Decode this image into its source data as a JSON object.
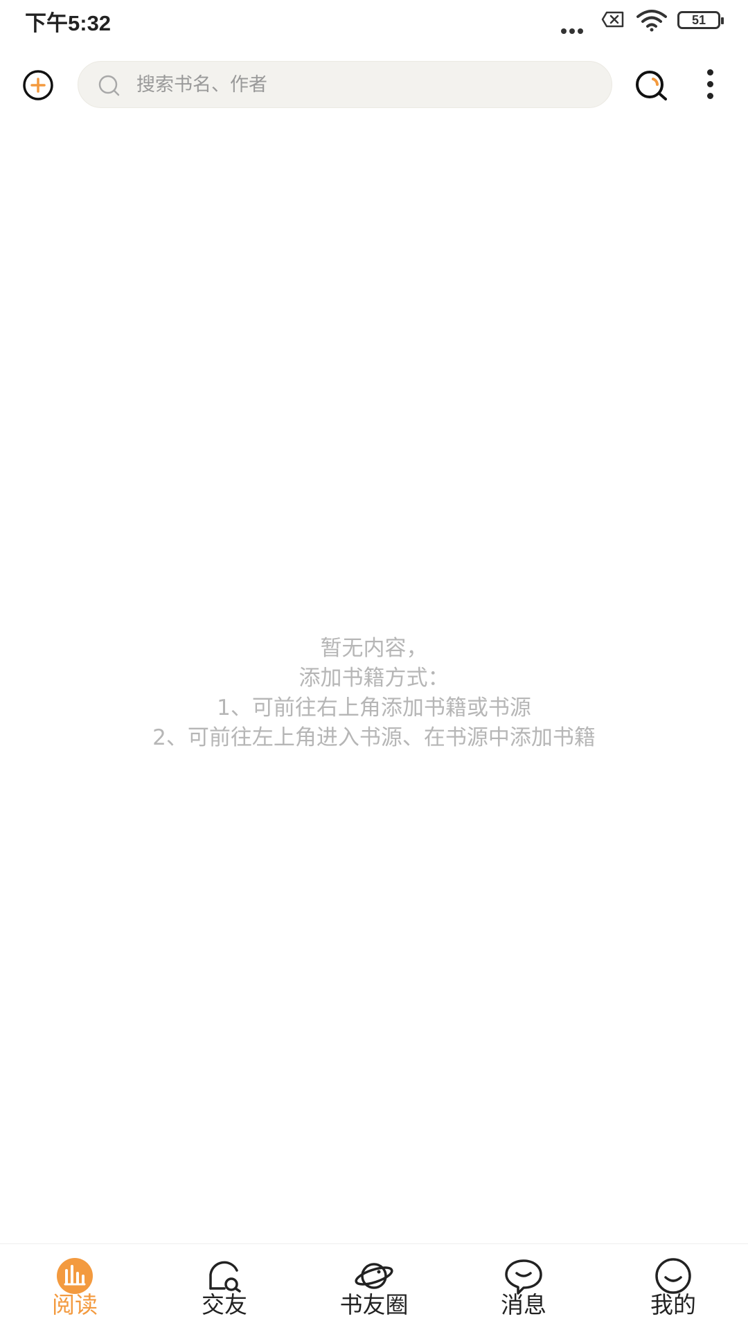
{
  "status_bar": {
    "time": "下午5:32",
    "battery": "51"
  },
  "top_bar": {
    "search_placeholder": "搜索书名、作者"
  },
  "empty_state": {
    "lines": [
      "暂无内容，",
      "添加书籍方式：",
      "1、可前往右上角添加书籍或书源",
      "2、可前往左上角进入书源、在书源中添加书籍"
    ]
  },
  "bottom_nav": {
    "items": [
      {
        "label": "阅读",
        "icon": "reading-icon",
        "active": true
      },
      {
        "label": "交友",
        "icon": "friends-icon",
        "active": false
      },
      {
        "label": "书友圈",
        "icon": "planet-icon",
        "active": false
      },
      {
        "label": "消息",
        "icon": "message-icon",
        "active": false
      },
      {
        "label": "我的",
        "icon": "profile-icon",
        "active": false
      }
    ]
  },
  "colors": {
    "accent": "#f39a3f",
    "search_bg": "#f3f2ee",
    "empty_text": "#b6b6b6"
  }
}
